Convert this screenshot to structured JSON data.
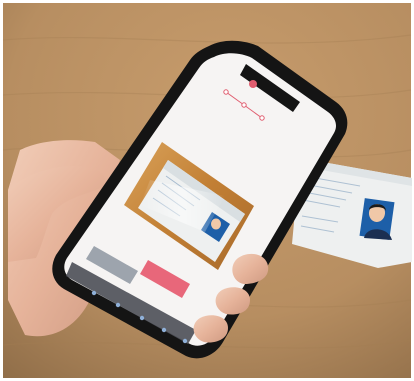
{
  "photo": {
    "subject": "hand-holding-smartphone-photographing-id-card",
    "colors": {
      "table": "#b88f63",
      "phone_body": "#141414",
      "screen_bg": "#f6f4f3",
      "accent": "#e05d6f",
      "card_bg": "#eef0f0",
      "card_face_bg": "#1d5fa8",
      "camera_frame_bg": "#c78735"
    }
  },
  "screen": {
    "title": "",
    "instructions": [
      "",
      "",
      "",
      "",
      ""
    ],
    "secondary_button": "",
    "primary_button": "",
    "url": ""
  }
}
